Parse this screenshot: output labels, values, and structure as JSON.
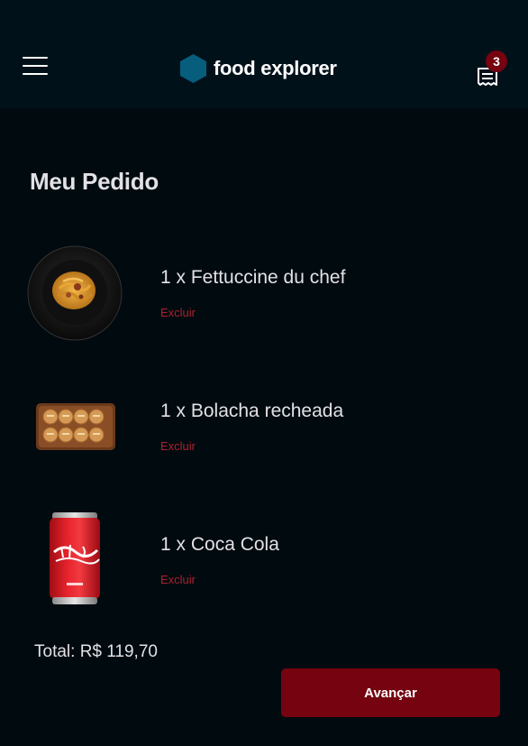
{
  "header": {
    "brand": "food explorer",
    "cart_count": "3",
    "brand_color": "#065e7c",
    "accent": "#750310"
  },
  "order": {
    "title": "Meu Pedido",
    "items": [
      {
        "name": "1 x Fettuccine du chef",
        "remove_label": "Excluir",
        "image": "pasta-plate-image"
      },
      {
        "name": "1 x Bolacha recheada",
        "remove_label": "Excluir",
        "image": "cookie-tray-image"
      },
      {
        "name": "1 x Coca Cola",
        "remove_label": "Excluir",
        "image": "coke-can-image"
      }
    ],
    "total": "Total: R$ 119,70",
    "advance_label": "Avançar"
  }
}
